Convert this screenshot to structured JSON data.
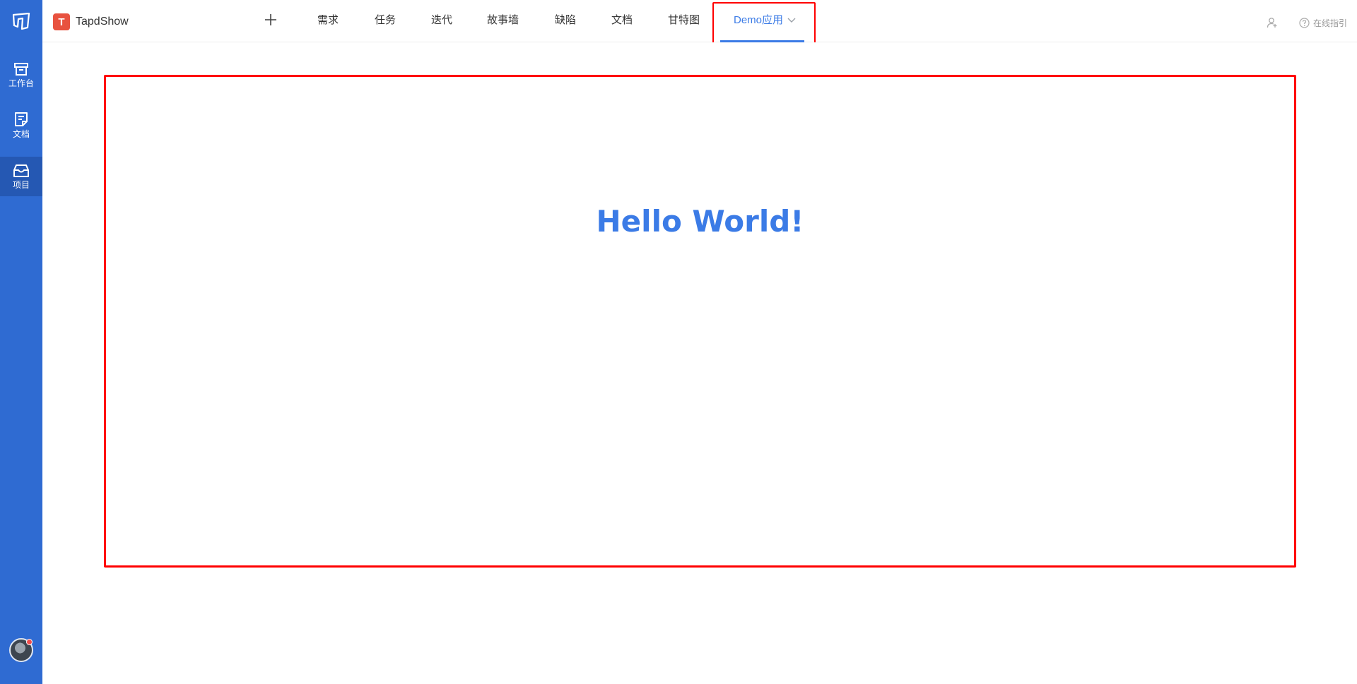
{
  "rail": {
    "items": [
      {
        "label": "工作台",
        "icon": "archive-box-icon"
      },
      {
        "label": "文档",
        "icon": "document-icon"
      },
      {
        "label": "项目",
        "icon": "inbox-icon",
        "active": true
      }
    ]
  },
  "header": {
    "project_badge": "T",
    "project_name": "TapdShow",
    "tabs": [
      {
        "label": "需求"
      },
      {
        "label": "任务"
      },
      {
        "label": "迭代"
      },
      {
        "label": "故事墙"
      },
      {
        "label": "缺陷"
      },
      {
        "label": "文档"
      },
      {
        "label": "甘特图"
      },
      {
        "label": "Demo应用",
        "active": true
      }
    ],
    "help_label": "在线指引"
  },
  "main": {
    "hello": "Hello World!"
  },
  "colors": {
    "rail_bg": "#2f6bd2",
    "accent": "#3b7be6",
    "highlight_border": "#ff0000",
    "project_badge": "#e8523f"
  }
}
